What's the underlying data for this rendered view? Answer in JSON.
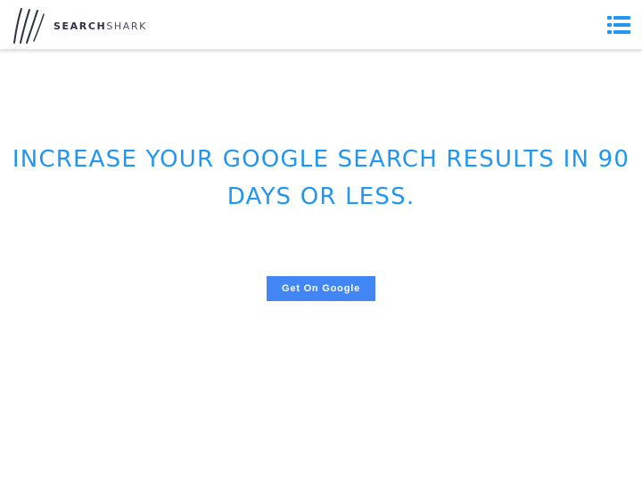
{
  "header": {
    "logo": {
      "text_bold": "SEARCH",
      "text_light": "SHARK"
    },
    "menu_icon": "list-menu-icon"
  },
  "hero": {
    "title": "INCREASE YOUR GOOGLE SEARCH RESULTS IN 90 DAYS OR LESS.",
    "cta_label": "Get On Google"
  },
  "colors": {
    "accent": "#2196f3",
    "button": "#4285f4",
    "logo_dark": "#2b3242"
  }
}
